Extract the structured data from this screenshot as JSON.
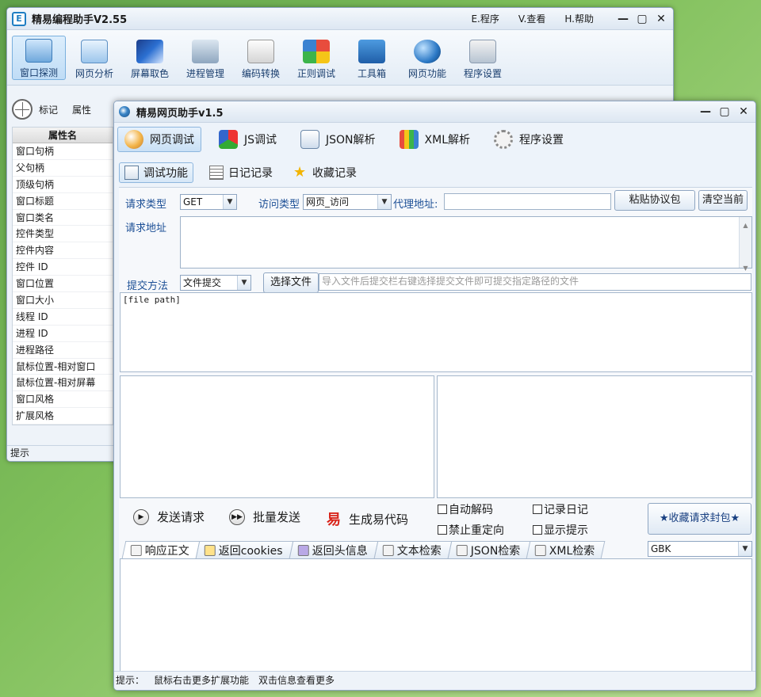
{
  "back_window": {
    "title": "精易编程助手V2.55",
    "menus": [
      "E.程序",
      "V.查看",
      "H.帮助"
    ],
    "window_buttons": [
      "—",
      "▢",
      "✕"
    ],
    "toolbar": [
      {
        "label": "窗口探测",
        "icon": "window-probe-icon",
        "active": true
      },
      {
        "label": "网页分析",
        "icon": "web-analysis-icon",
        "active": false
      },
      {
        "label": "屏幕取色",
        "icon": "screen-color-icon",
        "active": false
      },
      {
        "label": "进程管理",
        "icon": "process-manager-icon",
        "active": false
      },
      {
        "label": "编码转换",
        "icon": "encoding-convert-icon",
        "active": false
      },
      {
        "label": "正则调试",
        "icon": "regex-debug-icon",
        "active": false
      },
      {
        "label": "工具箱",
        "icon": "toolbox-icon",
        "active": false
      },
      {
        "label": "网页功能",
        "icon": "web-functions-icon",
        "active": false
      },
      {
        "label": "程序设置",
        "icon": "program-settings-icon",
        "active": false
      }
    ],
    "sidebar": {
      "mark_label": "标记",
      "attr_label": "属性"
    },
    "prop_table": {
      "header": "属性名",
      "rows": [
        "窗口句柄",
        "父句柄",
        "顶级句柄",
        "窗口标题",
        "窗口类名",
        "控件类型",
        "控件内容",
        "控件 ID",
        "窗口位置",
        "窗口大小",
        "线程 ID",
        "进程 ID",
        "进程路径",
        "鼠标位置-相对窗口",
        "鼠标位置-相对屏幕",
        "窗口风格",
        "扩展风格"
      ]
    },
    "status": "提示"
  },
  "front_window": {
    "title": "精易网页助手v1.5",
    "tabs": [
      {
        "label": "网页调试",
        "active": true
      },
      {
        "label": "JS调试",
        "active": false
      },
      {
        "label": "JSON解析",
        "active": false
      },
      {
        "label": "XML解析",
        "active": false
      },
      {
        "label": "程序设置",
        "active": false
      }
    ],
    "subtabs": [
      {
        "label": "调试功能",
        "active": true
      },
      {
        "label": "日记记录",
        "active": false
      },
      {
        "label": "收藏记录",
        "active": false
      }
    ],
    "form": {
      "request_type_label": "请求类型",
      "request_type_value": "GET",
      "access_type_label": "访问类型",
      "access_type_value": "网页_访问",
      "proxy_label": "代理地址:",
      "proxy_value": "",
      "paste_button": "粘贴协议包",
      "clear_button": "清空当前",
      "url_label": "请求地址",
      "url_value": "",
      "submit_method_label": "提交方法",
      "submit_method_value": "文件提交",
      "choose_file_button": "选择文件",
      "file_hint_placeholder": "导入文件后提交栏右键选择提交文件即可提交指定路径的文件",
      "file_path_text": "[file path]"
    },
    "actions": {
      "send": "发送请求",
      "batch": "批量发送",
      "generate": "生成易代码",
      "generate_glyph": "易",
      "favorite_button": "★收藏请求封包★"
    },
    "checkboxes": [
      "自动解码",
      "记录日记",
      "禁止重定向",
      "显示提示"
    ],
    "result_tabs": [
      {
        "label": "响应正文",
        "active": true
      },
      {
        "label": "返回cookies",
        "active": false
      },
      {
        "label": "返回头信息",
        "active": false
      },
      {
        "label": "文本检索",
        "active": false
      },
      {
        "label": "JSON检索",
        "active": false
      },
      {
        "label": "XML检索",
        "active": false
      }
    ],
    "encoding": "GBK",
    "status": {
      "label": "提示：",
      "msg1": "鼠标右击更多扩展功能",
      "msg2": "双击信息查看更多"
    }
  }
}
